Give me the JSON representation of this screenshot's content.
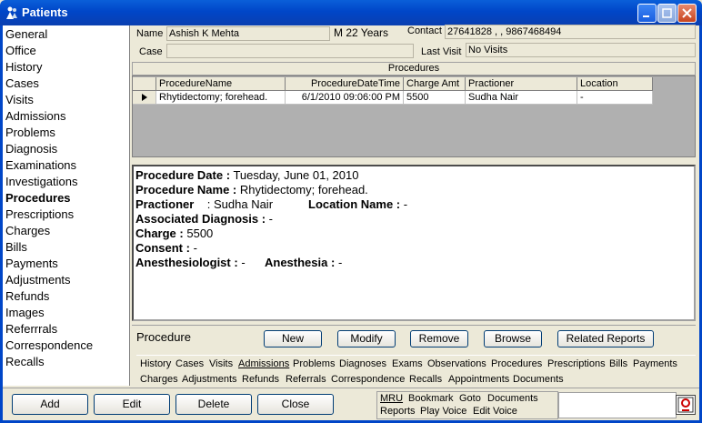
{
  "window": {
    "title": "Patients"
  },
  "nav": {
    "items": [
      "General",
      "Office",
      "History",
      "Cases",
      "Visits",
      "Admissions",
      "Problems",
      "Diagnosis",
      "Examinations",
      "Investigations",
      "Procedures",
      "Prescriptions",
      "Charges",
      "Bills",
      "Payments",
      "Adjustments",
      "Refunds",
      "Images",
      "Referrrals",
      "Correspondence",
      "Recalls"
    ],
    "active": "Procedures"
  },
  "header": {
    "name_label": "Name",
    "name_value": "Ashish K Mehta",
    "age_value": "M 22 Years",
    "contact_label": "Contact",
    "contact_value": "27641828 , , 9867468494",
    "case_label": "Case",
    "case_value": "",
    "last_visit_label": "Last Visit",
    "last_visit_value": "No Visits"
  },
  "procedures_grid": {
    "title": "Procedures",
    "columns": [
      "ProcedureName",
      "ProcedureDateTime",
      "Charge Amt",
      "Practioner",
      "Location"
    ],
    "rows": [
      [
        "Rhytidectomy; forehead.",
        "6/1/2010 09:06:00 PM",
        "5500",
        "Sudha Nair",
        "-"
      ]
    ]
  },
  "details": {
    "procedure_date_label": "Procedure Date :",
    "procedure_date": "Tuesday, June 01, 2010",
    "procedure_name_label": "Procedure Name :",
    "procedure_name": "Rhytidectomy; forehead.",
    "practioner_label": "Practioner",
    "practioner": ": Sudha Nair",
    "location_label": "Location Name :",
    "location": "-",
    "diagnosis_label": "Associated Diagnosis :",
    "diagnosis": "-",
    "charge_label": "Charge :",
    "charge": "5500",
    "consent_label": "Consent :",
    "consent": "-",
    "anesthesiologist_label": "Anesthesiologist :",
    "anesthesiologist": "-",
    "anesthesia_label": "Anesthesia :",
    "anesthesia": "-"
  },
  "actionbar": {
    "title": "Procedure",
    "buttons": [
      "New",
      "Modify",
      "Remove",
      "Browse",
      "Related Reports"
    ]
  },
  "links": {
    "row1": [
      "History",
      "Cases",
      "Visits",
      "Admissions",
      "Problems",
      "Diagnoses",
      "Exams",
      "Observations",
      "Procedures",
      "Prescriptions",
      "Bills",
      "Payments"
    ],
    "row2": [
      "Charges",
      "Adjustments",
      "Refunds",
      "Referrals",
      "Correspondence",
      "Recalls",
      "Appointments",
      "Documents"
    ]
  },
  "bottom": {
    "buttons": [
      "Add",
      "Edit",
      "Delete",
      "Close"
    ],
    "mru": [
      "MRU",
      "Bookmark",
      "Goto",
      "Documents"
    ],
    "mru2": [
      "Reports",
      "Play Voice",
      "Edit Voice"
    ]
  }
}
